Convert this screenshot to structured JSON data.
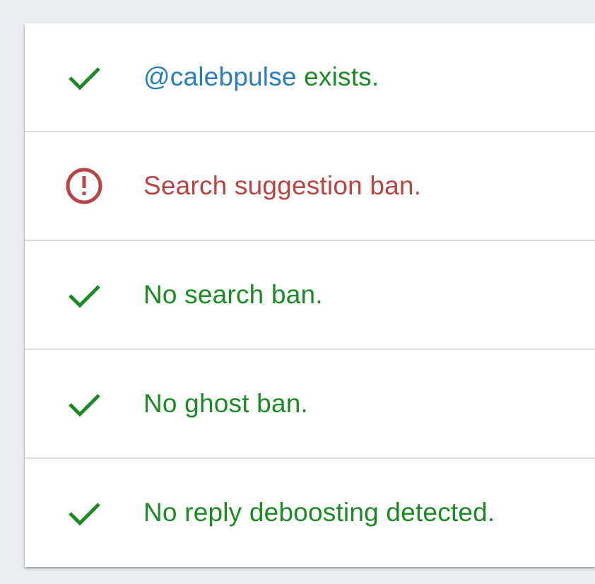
{
  "colors": {
    "ok": "#1b8a25",
    "err": "#b94444",
    "link": "#2a7db8",
    "background": "#e9edf1",
    "card": "#ffffff",
    "divider": "#dcdcdc"
  },
  "results": [
    {
      "status": "ok",
      "icon": "check-icon",
      "handle": "@calebpulse",
      "text": " exists."
    },
    {
      "status": "error",
      "icon": "alert-circle-icon",
      "text": "Search suggestion ban."
    },
    {
      "status": "ok",
      "icon": "check-icon",
      "text": "No search ban."
    },
    {
      "status": "ok",
      "icon": "check-icon",
      "text": "No ghost ban."
    },
    {
      "status": "ok",
      "icon": "check-icon",
      "text": "No reply deboosting detected."
    }
  ]
}
